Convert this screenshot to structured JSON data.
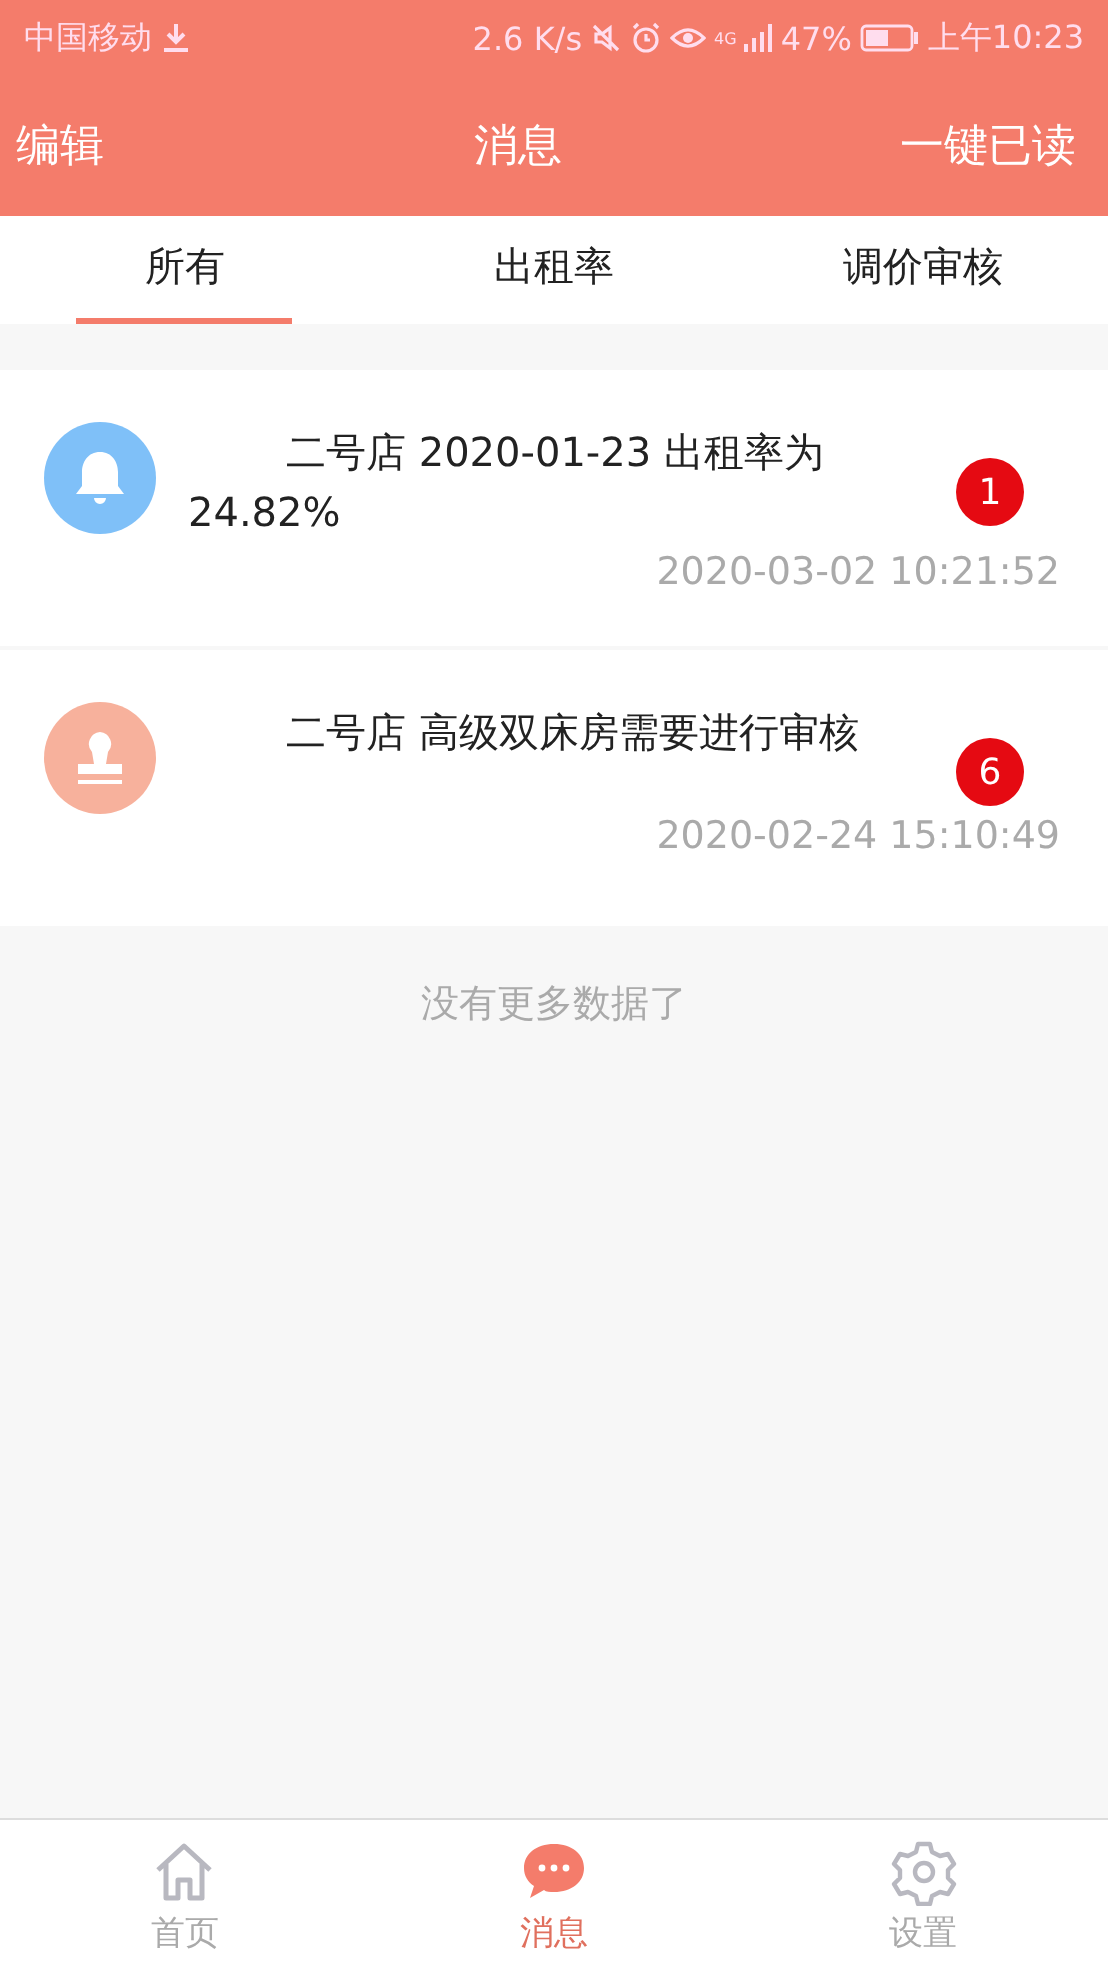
{
  "status_bar": {
    "carrier": "中国移动",
    "speed": "2.6 K/s",
    "network": "4G",
    "battery": "47%",
    "time": "上午10:23"
  },
  "header": {
    "left": "编辑",
    "title": "消息",
    "right": "一键已读"
  },
  "tabs": [
    {
      "label": "所有",
      "selected": true
    },
    {
      "label": "出租率",
      "selected": false
    },
    {
      "label": "调价审核",
      "selected": false
    }
  ],
  "messages": [
    {
      "kind": "bell",
      "text": "二号店 2020-01-23 出租率为 24.82%",
      "count": "1",
      "time": "2020-03-02 10:21:52"
    },
    {
      "kind": "stamp",
      "text": "二号店 高级双床房需要进行审核",
      "count": "6",
      "time": "2020-02-24 15:10:49"
    }
  ],
  "end_note": "没有更多数据了",
  "nav": [
    {
      "kind": "home",
      "label": "首页",
      "selected": false
    },
    {
      "kind": "chat",
      "label": "消息",
      "selected": true
    },
    {
      "kind": "gear",
      "label": "设置",
      "selected": false
    }
  ]
}
